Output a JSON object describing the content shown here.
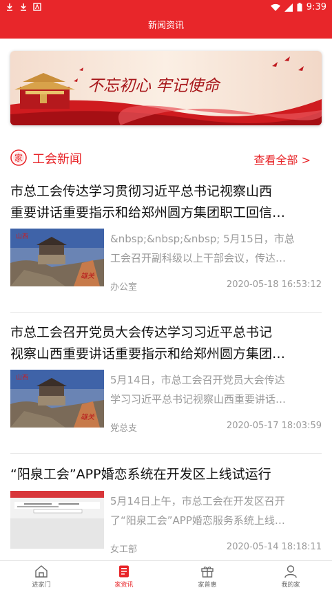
{
  "status_bar": {
    "time": "9:39"
  },
  "header": {
    "title": "新闻资讯"
  },
  "banner": {
    "calligraphy": "不忘初心 牢记使命"
  },
  "section": {
    "icon_text": "家",
    "title": "工会新闻",
    "more_label": "查看全部 >"
  },
  "news": [
    {
      "title_lines": [
        "市总工会传达学习贯彻习近平总书记视察山西",
        "重要讲话重要指示和给郑州圆方集团职工回信…"
      ],
      "summary_lines": [
        "&nbsp;&nbsp;&nbsp; 5月15日，市总",
        "工会召开副科级以上干部会议，传达…"
      ],
      "department": "办公室",
      "time": "2020-05-18 16:53:12",
      "thumb_caption": "山西"
    },
    {
      "title_lines": [
        "市总工会召开党员大会传达学习习近平总书记",
        "视察山西重要讲话重要指示和给郑州圆方集团…"
      ],
      "summary_lines": [
        "5月14日，市总工会召开党员大会传达",
        "学习习近平总书记视察山西重要讲话…"
      ],
      "department": "党总支",
      "time": "2020-05-17 18:03:59",
      "thumb_caption": "山西"
    },
    {
      "title_lines": [
        "“阳泉工会”APP婚恋系统在开发区上线试运行"
      ],
      "summary_lines": [
        "5月14日上午，市总工会在开发区召开",
        "了“阳泉工会”APP婚恋服务系统上线…"
      ],
      "department": "女工部",
      "time": "2020-05-14 18:18:11"
    }
  ],
  "tabs": [
    {
      "label": "进家门",
      "icon": "home-icon"
    },
    {
      "label": "家资讯",
      "icon": "news-icon",
      "active": true
    },
    {
      "label": "家普惠",
      "icon": "gift-icon"
    },
    {
      "label": "我的家",
      "icon": "user-icon"
    }
  ],
  "colors": {
    "brand_red": "#e8262a"
  }
}
